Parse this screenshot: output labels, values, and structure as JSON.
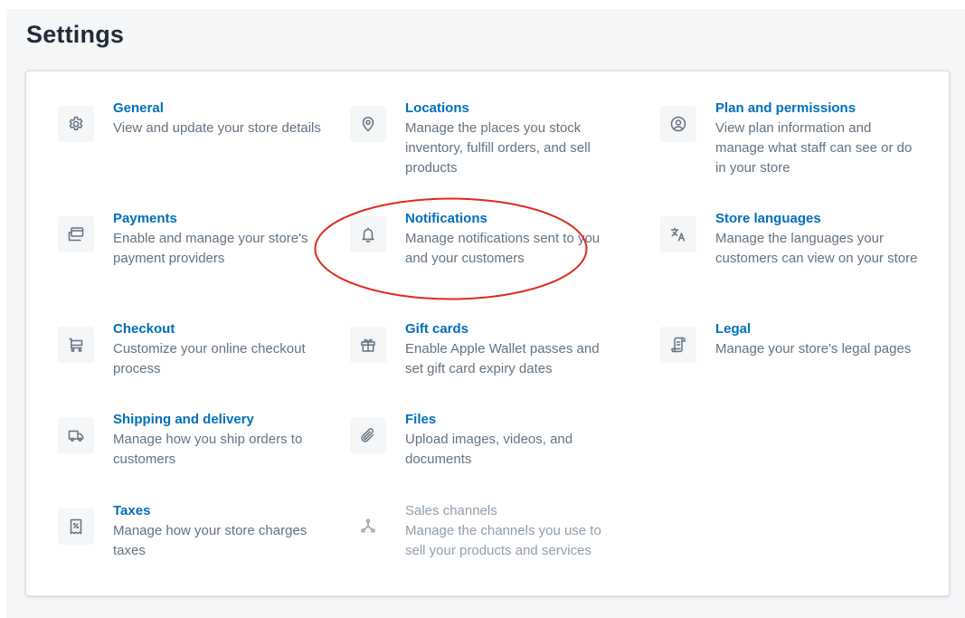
{
  "page": {
    "title": "Settings"
  },
  "settings": {
    "items": [
      {
        "key": "general",
        "title": "General",
        "description": "View and update your store details",
        "icon": "gear-icon"
      },
      {
        "key": "locations",
        "title": "Locations",
        "description": "Manage the places you stock inventory, fulfill orders, and sell products",
        "icon": "map-pin-icon"
      },
      {
        "key": "plan",
        "title": "Plan and permissions",
        "description": "View plan information and manage what staff can see or do in your store",
        "icon": "user-circle-icon"
      },
      {
        "key": "payments",
        "title": "Payments",
        "description": "Enable and manage your store's payment providers",
        "icon": "credit-card-icon"
      },
      {
        "key": "notifications",
        "title": "Notifications",
        "description": "Manage notifications sent to you and your customers",
        "icon": "bell-icon"
      },
      {
        "key": "languages",
        "title": "Store languages",
        "description": "Manage the languages your customers can view on your store",
        "icon": "translate-icon"
      },
      {
        "key": "checkout",
        "title": "Checkout",
        "description": "Customize your online checkout process",
        "icon": "cart-icon"
      },
      {
        "key": "gift-cards",
        "title": "Gift cards",
        "description": "Enable Apple Wallet passes and set gift card expiry dates",
        "icon": "gift-icon"
      },
      {
        "key": "legal",
        "title": "Legal",
        "description": "Manage your store's legal pages",
        "icon": "document-icon"
      },
      {
        "key": "shipping",
        "title": "Shipping and delivery",
        "description": "Manage how you ship orders to customers",
        "icon": "truck-icon"
      },
      {
        "key": "files",
        "title": "Files",
        "description": "Upload images, videos, and documents",
        "icon": "paperclip-icon"
      },
      {
        "key": "taxes",
        "title": "Taxes",
        "description": "Manage how your store charges taxes",
        "icon": "tax-receipt-icon"
      },
      {
        "key": "sales-channels",
        "title": "Sales channels",
        "description": "Manage the channels you use to sell your products and services",
        "icon": "channels-icon",
        "disabled": true
      }
    ]
  },
  "colors": {
    "link": "#006fbb",
    "text_subdued": "#637381",
    "text_disabled": "#919eab",
    "annotation": "#e0291e"
  }
}
